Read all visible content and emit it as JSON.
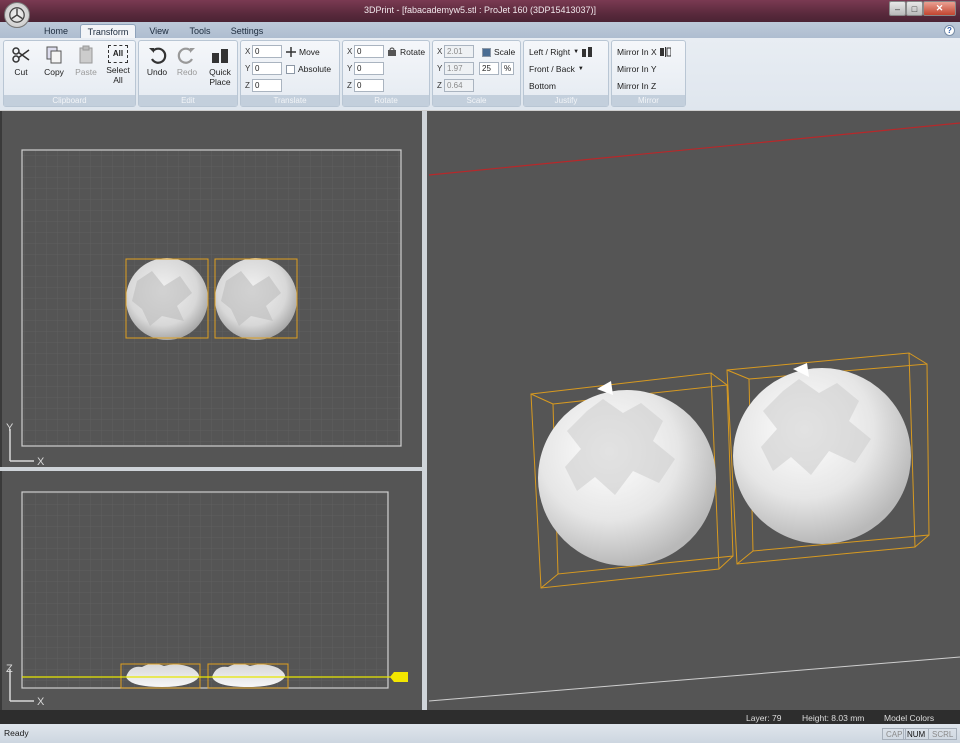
{
  "window": {
    "title": "3DPrint - [fabacademyw5.stl : ProJet 160 (3DP15413037)]",
    "minimize_glyph": "–",
    "maximize_glyph": "□",
    "close_glyph": "✕"
  },
  "tabs": [
    {
      "label": "Home",
      "active": false
    },
    {
      "label": "Transform",
      "active": true
    },
    {
      "label": "View",
      "active": false
    },
    {
      "label": "Tools",
      "active": false
    },
    {
      "label": "Settings",
      "active": false
    }
  ],
  "help_glyph": "?",
  "ribbon": {
    "clipboard": {
      "label": "Clipboard",
      "cut": "Cut",
      "copy": "Copy",
      "paste": "Paste",
      "select_all": "Select All",
      "select_all_icon_text": "All"
    },
    "edit": {
      "label": "Edit",
      "undo": "Undo",
      "redo": "Redo",
      "quick_place": "Quick Place"
    },
    "translate": {
      "label": "Translate",
      "x_label": "X",
      "x": "0",
      "y_label": "Y",
      "y": "0",
      "z_label": "Z",
      "z": "0",
      "move": "Move",
      "absolute": "Absolute"
    },
    "rotate": {
      "label": "Rotate",
      "x_label": "X",
      "x": "0",
      "y_label": "Y",
      "y": "0",
      "z_label": "Z",
      "z": "0",
      "rotate": "Rotate"
    },
    "scale": {
      "label": "Scale",
      "x_label": "X",
      "x": "2.01",
      "y_label": "Y",
      "y": "1.97",
      "z_label": "Z",
      "z": "0.64",
      "scale": "Scale",
      "percent": "25",
      "percent_unit": "%"
    },
    "justify": {
      "label": "Justify",
      "left_right": "Left / Right",
      "front_back": "Front / Back",
      "bottom": "Bottom"
    },
    "mirror": {
      "label": "Mirror",
      "x": "Mirror In X",
      "y": "Mirror In Y",
      "z": "Mirror In Z"
    }
  },
  "viewports": {
    "top_axes": {
      "vertical": "Y",
      "horizontal": "X"
    },
    "front_axes": {
      "vertical": "Z",
      "horizontal": "X"
    }
  },
  "colors": {
    "viewport_bg": "#555555",
    "grid_line": "#606060",
    "bounding_box": "#e0a020",
    "build_line": "#e6e600",
    "axis_red": "#b8282a"
  },
  "status": {
    "layer": "Layer: 79",
    "height": "Height: 8.03 mm",
    "mode": "Model Colors",
    "ready": "Ready",
    "cap": "CAP",
    "num": "NUM",
    "scrl": "SCRL"
  }
}
